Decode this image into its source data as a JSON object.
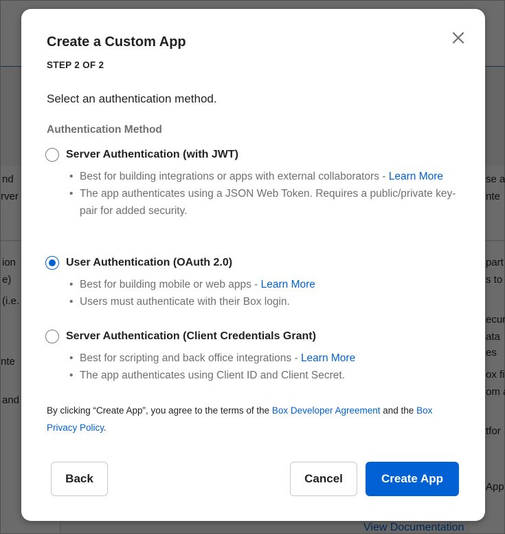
{
  "modal": {
    "title": "Create a Custom App",
    "step": "STEP 2 OF 2",
    "prompt": "Select an authentication method.",
    "section_label": "Authentication Method",
    "close_icon": "close-icon",
    "options": [
      {
        "label": "Server Authentication (with JWT)",
        "selected": false,
        "bullets": [
          {
            "text": "Best for building integrations or apps with external collaborators - ",
            "link": "Learn More"
          },
          {
            "text": "The app authenticates using a JSON Web Token. Requires a public/private key-pair for added security.",
            "link": ""
          }
        ]
      },
      {
        "label": "User Authentication (OAuth 2.0)",
        "selected": true,
        "bullets": [
          {
            "text": "Best for building mobile or web apps - ",
            "link": "Learn More"
          },
          {
            "text": "Users must authenticate with their Box login.",
            "link": ""
          }
        ]
      },
      {
        "label": "Server Authentication (Client Credentials Grant)",
        "selected": false,
        "bullets": [
          {
            "text": "Best for scripting and back office integrations - ",
            "link": "Learn More"
          },
          {
            "text": "The app authenticates using Client ID and Client Secret.",
            "link": ""
          }
        ]
      }
    ],
    "agreement": {
      "prefix": "By clicking “Create App”, you agree to the terms of the ",
      "link1": "Box Developer Agreement",
      "middle": " and the ",
      "link2": "Box Privacy Policy",
      "suffix": "."
    },
    "buttons": {
      "back": "Back",
      "cancel": "Cancel",
      "create": "Create App"
    }
  },
  "background": {
    "fragments": [
      "nd",
      "rver",
      "ion",
      "e)",
      "(i.e.",
      "nte",
      "and",
      "se a",
      "nte",
      "part",
      "s to",
      "ecur",
      "ata",
      "es",
      "ox fi",
      "om a",
      "tfor",
      "App"
    ],
    "link": "View Documentation"
  },
  "colors": {
    "accent": "#0061d5",
    "text": "#222222",
    "muted": "#6f6f6f"
  }
}
